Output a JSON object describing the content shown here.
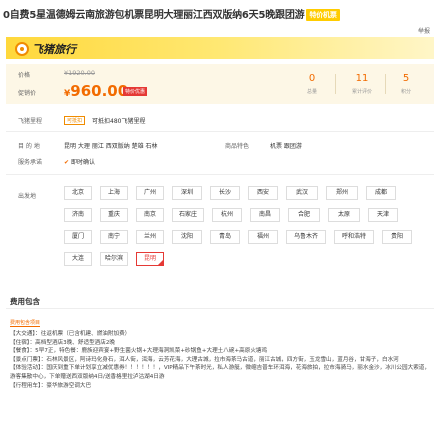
{
  "title": {
    "text": "0自费5星温德姆云南旅游包机票昆明大理丽江西双版纳6天5晚跟团游",
    "badge": "特价机票"
  },
  "report_label": "举报",
  "brand": {
    "name": "飞猪旅行"
  },
  "price": {
    "orig_label": "价格",
    "orig_value": "¥1920.00",
    "promo_label": "促销价",
    "currency": "¥",
    "value": "960.00",
    "badge": "特价优惠"
  },
  "stats": [
    {
      "value": "0",
      "label": "总量"
    },
    {
      "value": "11",
      "label": "累计评价"
    },
    {
      "value": "5",
      "label": "积分"
    }
  ],
  "flight": {
    "label": "飞猪里程",
    "tag": "可抵扣",
    "text": "可抵扣480飞猪里程"
  },
  "destinations": {
    "label": "目 的 地",
    "value": "昆明 大理 丽江 西双版纳 楚雄 石林",
    "extra_label": "商品特色",
    "extra_value": "机票 跟团游"
  },
  "service": {
    "label": "服务承诺",
    "value": "即时确认"
  },
  "departure": {
    "label": "出发地",
    "rows": [
      [
        "北京",
        "上海",
        "广州",
        "深圳",
        "长沙",
        "西安",
        "武汉",
        "郑州",
        "成都"
      ],
      [
        "济南",
        "重庆",
        "南京",
        "石家庄",
        "杭州",
        "南昌",
        "合肥",
        "太原",
        "天津"
      ],
      [
        "厦门",
        "南宁",
        "兰州",
        "沈阳",
        "青岛",
        "福州",
        "乌鲁木齐",
        "呼和浩特",
        "贵阳"
      ],
      [
        "大连",
        "哈尔滨",
        "昆明"
      ]
    ],
    "selected": "昆明"
  },
  "fees": {
    "section_title": "费用包含",
    "tag": "费用包含项目",
    "lines": [
      "【大交通】：往返机票（已含机建、燃油附加费）",
      "【住宿】：高档型酒店3晚、舒适型酒店2晚",
      "【餐食】：5早7正，特色餐：鹿族迎宾宴+野生菌火锅+大理海洞凯菜+砂锅鱼+大理土八碗+高原火塘鸡",
      "【景点门票】：石林风景区，阿诗玛化身石，洱人街，洱海，云芳花海，大理古城，拉市海茶马古道，丽江古城，四方街，玉龙雪山，蓝月谷，甘海子，白水河",
      "【体验活动】：国庆到重下单计划享立减优惠券！！！！！！，VIP精品下午茶时光，私人游艇，微缩吉普车环洱海，花海旅拍，拉市海骑马，丽水金沙，冰川公园大索道，游客集散中心，下单赠送西双版纳4日/送香格里拉泸沽湖4日游",
      "【行程用车】：豪华旅游空调大巴"
    ]
  }
}
